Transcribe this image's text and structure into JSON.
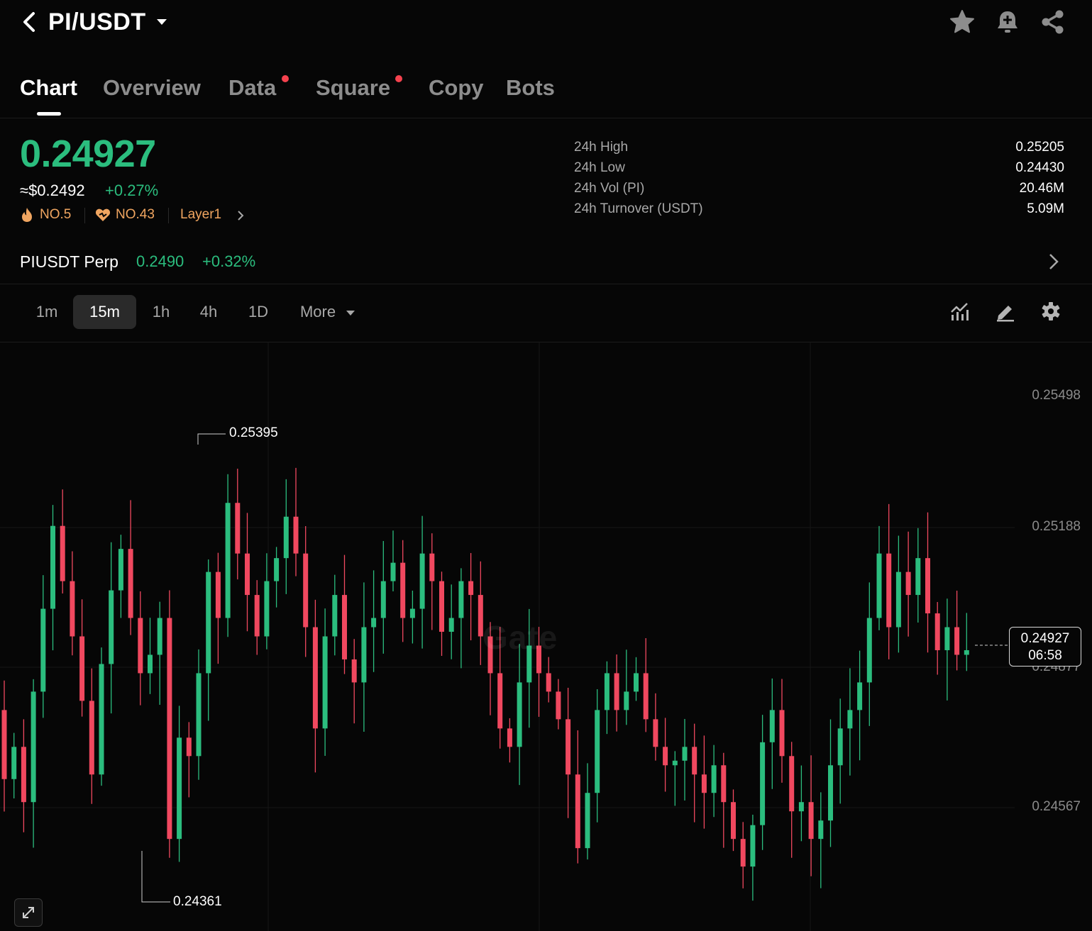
{
  "header": {
    "pair": "PI/USDT",
    "icons": [
      "back-arrow-icon",
      "caret-down-icon",
      "star-icon",
      "alert-bell-icon",
      "share-icon"
    ]
  },
  "tabs": [
    {
      "label": "Chart",
      "active": true,
      "dot": false
    },
    {
      "label": "Overview",
      "active": false,
      "dot": false
    },
    {
      "label": "Data",
      "active": false,
      "dot": true
    },
    {
      "label": "Square",
      "active": false,
      "dot": true
    },
    {
      "label": "Copy",
      "active": false,
      "dot": false
    },
    {
      "label": "Bots",
      "active": false,
      "dot": false
    }
  ],
  "ticker": {
    "price": "0.24927",
    "usd_price": "≈$0.2492",
    "change": "+0.27%",
    "badges": {
      "rank_hot": "NO.5",
      "rank_fav": "NO.43",
      "category": "Layer1"
    }
  },
  "stats": {
    "high_label": "24h High",
    "high_value": "0.25205",
    "low_label": "24h Low",
    "low_value": "0.24430",
    "vol_label": "24h Vol (PI)",
    "vol_value": "20.46M",
    "turnover_label": "24h Turnover (USDT)",
    "turnover_value": "5.09M"
  },
  "perp": {
    "name": "PIUSDT Perp",
    "price": "0.2490",
    "change": "+0.32%"
  },
  "timeframes": {
    "items": [
      "1m",
      "15m",
      "1h",
      "4h",
      "1D"
    ],
    "active": "15m",
    "more_label": "More"
  },
  "chart": {
    "watermark": "Gate",
    "axis_labels": [
      "0.25498",
      "0.25188",
      "0.24877",
      "0.24567"
    ],
    "high_marker": "0.25395",
    "low_marker": "0.24361",
    "current_price": "0.24927",
    "countdown": "06:58"
  },
  "colors": {
    "up": "#2bbd7e",
    "down": "#f0485f",
    "accent_badge": "#f0a560",
    "dot": "#f5424e"
  },
  "chart_data": {
    "type": "candlestick",
    "title": "",
    "xlabel": "",
    "ylabel": "",
    "ylim": [
      0.2432,
      0.256
    ],
    "y_ticks": [
      0.25498,
      0.25188,
      0.24877,
      0.24567
    ],
    "high": 0.25395,
    "low": 0.24361,
    "last": 0.24927,
    "closes": [
      0.2465,
      0.2472,
      0.246,
      0.2484,
      0.2502,
      0.252,
      0.2508,
      0.2496,
      0.2482,
      0.2466,
      0.249,
      0.2506,
      0.2515,
      0.25,
      0.2488,
      0.2492,
      0.25,
      0.2452,
      0.2474,
      0.247,
      0.2488,
      0.251,
      0.25,
      0.2525,
      0.2514,
      0.2505,
      0.2496,
      0.2508,
      0.2513,
      0.2522,
      0.2514,
      0.2498,
      0.2476,
      0.2496,
      0.2505,
      0.2491,
      0.2486,
      0.2498,
      0.25,
      0.2508,
      0.2512,
      0.25,
      0.2502,
      0.2514,
      0.2508,
      0.2497,
      0.25,
      0.2508,
      0.2505,
      0.2496,
      0.2488,
      0.2476,
      0.2472,
      0.2486,
      0.2494,
      0.2488,
      0.2484,
      0.2478,
      0.2466,
      0.245,
      0.2462,
      0.248,
      0.2488,
      0.248,
      0.2484,
      0.2488,
      0.2478,
      0.2472,
      0.2468,
      0.2469,
      0.2472,
      0.2466,
      0.2462,
      0.2468,
      0.246,
      0.2452,
      0.2446,
      0.2455,
      0.2473,
      0.248,
      0.247,
      0.2458,
      0.246,
      0.2452,
      0.2456,
      0.2468,
      0.2476,
      0.248,
      0.2486,
      0.25,
      0.2514,
      0.2498,
      0.251,
      0.2505,
      0.2513,
      0.2501,
      0.2493,
      0.2498,
      0.2492,
      0.2493
    ]
  }
}
